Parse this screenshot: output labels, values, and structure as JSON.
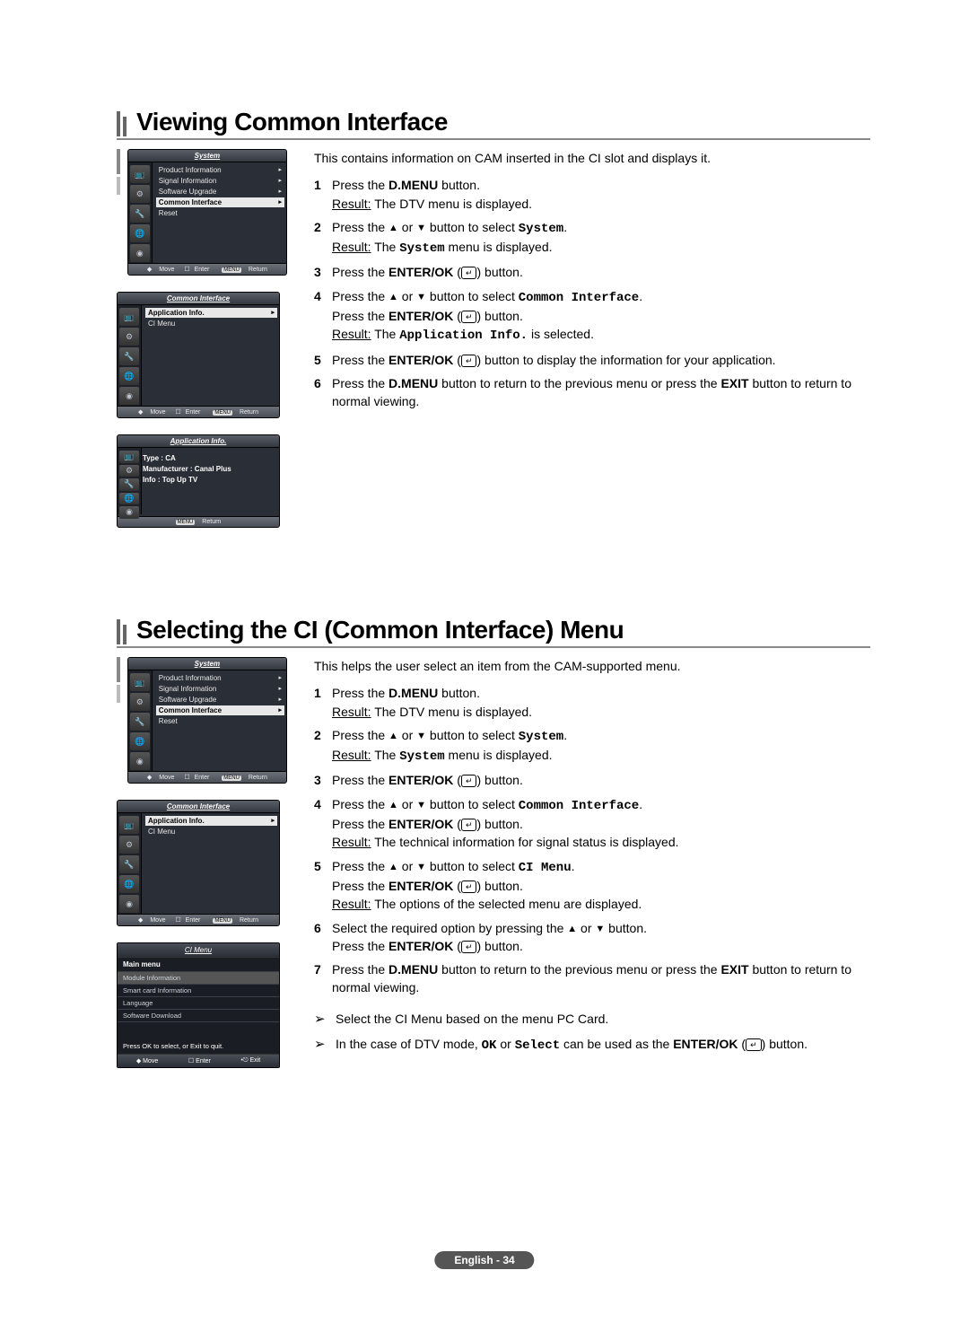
{
  "section1": {
    "heading": "Viewing Common Interface",
    "intro": "This contains information on CAM inserted in the CI slot and displays it.",
    "steps": {
      "s1_a": "Press the ",
      "s1_b": "D.MENU",
      "s1_c": " button.",
      "s1_r1": "Result:",
      "s1_r2": " The DTV menu is displayed.",
      "s2_a": "Press the ",
      "s2_b": " or ",
      "s2_c": " button to select ",
      "s2_d": "System",
      "s2_e": ".",
      "s2_r1": "Result:",
      "s2_r2": " The ",
      "s2_r3": "System",
      "s2_r4": " menu is displayed.",
      "s3_a": "Press the ",
      "s3_b": "ENTER/OK",
      "s3_c": " (",
      "s3_d": ") button.",
      "s4_a": "Press the ",
      "s4_b": " or ",
      "s4_c": " button to select ",
      "s4_d": "Common Interface",
      "s4_e": ".",
      "s4_f": "Press the ",
      "s4_g": "ENTER/OK",
      "s4_h": " (",
      "s4_i": ") button.",
      "s4_r1": "Result:",
      "s4_r2": " The ",
      "s4_r3": "Application Info.",
      "s4_r4": " is selected.",
      "s5_a": "Press the ",
      "s5_b": "ENTER/OK",
      "s5_c": " (",
      "s5_d": ") button to display the information for your application.",
      "s6_a": "Press the ",
      "s6_b": "D.MENU",
      "s6_c": " button to return to the previous menu or press the ",
      "s6_d": "EXIT",
      "s6_e": " button to return to normal viewing."
    },
    "osd1": {
      "title": "System",
      "items": [
        "Product Information",
        "Signal Information",
        "Software Upgrade",
        "Common Interface",
        "Reset"
      ],
      "selected": "Common Interface",
      "hints": {
        "move": "Move",
        "enter": "Enter",
        "ret": "Return"
      }
    },
    "osd2": {
      "title": "Common Interface",
      "items": [
        "Application Info.",
        "CI Menu"
      ],
      "selected": "Application Info.",
      "hints": {
        "move": "Move",
        "enter": "Enter",
        "ret": "Return"
      }
    },
    "osd3": {
      "title": "Application Info.",
      "type": "Type : CA",
      "manu": "Manufacturer : Canal Plus",
      "info": "Info : Top Up TV",
      "hints": {
        "ret": "Return"
      }
    }
  },
  "section2": {
    "heading": "Selecting the CI (Common Interface) Menu",
    "intro": "This helps the user select an item from the CAM-supported menu.",
    "steps": {
      "s1_a": "Press the ",
      "s1_b": "D.MENU",
      "s1_c": " button.",
      "s1_r1": "Result:",
      "s1_r2": " The DTV menu is displayed.",
      "s2_a": "Press the ",
      "s2_b": " or ",
      "s2_c": " button to select ",
      "s2_d": "System",
      "s2_e": ".",
      "s2_r1": "Result:",
      "s2_r2": " The ",
      "s2_r3": "System",
      "s2_r4": " menu is displayed.",
      "s3_a": "Press the ",
      "s3_b": "ENTER/OK",
      "s3_c": " (",
      "s3_d": ") button.",
      "s4_a": "Press the ",
      "s4_b": " or ",
      "s4_c": " button to select ",
      "s4_d": "Common Interface",
      "s4_e": ".",
      "s4_f": "Press the ",
      "s4_g": "ENTER/OK",
      "s4_h": " (",
      "s4_i": ") button.",
      "s4_r1": "Result:",
      "s4_r2": " The technical information for signal status is displayed.",
      "s5_a": "Press the ",
      "s5_b": " or ",
      "s5_c": " button to select ",
      "s5_d": "CI Menu",
      "s5_e": ".",
      "s5_f": "Press the ",
      "s5_g": "ENTER/OK",
      "s5_h": " (",
      "s5_i": ") button.",
      "s5_r1": "Result:",
      "s5_r2": " The options of the selected menu are displayed.",
      "s6_a": "Select the required option by pressing the ",
      "s6_b": " or ",
      "s6_c": " button.",
      "s6_d": "Press the ",
      "s6_e": "ENTER/OK",
      "s6_f": " (",
      "s6_g": ") button.",
      "s7_a": "Press the ",
      "s7_b": "D.MENU",
      "s7_c": " button to return to the previous menu or press the ",
      "s7_d": "EXIT",
      "s7_e": " button to return to normal viewing."
    },
    "notes": {
      "n1": "Select the CI Menu based on the menu PC Card.",
      "n2_a": "In the case of DTV mode, ",
      "n2_b": "OK",
      "n2_c": " or ",
      "n2_d": "Select",
      "n2_e": " can be used as the ",
      "n2_f": "ENTER/OK",
      "n2_g": " (",
      "n2_h": ") button."
    },
    "osd1": {
      "title": "System",
      "items": [
        "Product Information",
        "Signal Information",
        "Software Upgrade",
        "Common Interface",
        "Reset"
      ],
      "selected": "Common Interface",
      "hints": {
        "move": "Move",
        "enter": "Enter",
        "ret": "Return"
      }
    },
    "osd2": {
      "title": "Common Interface",
      "items": [
        "Application Info.",
        "CI Menu"
      ],
      "selected": "Application Info.",
      "hints": {
        "move": "Move",
        "enter": "Enter",
        "ret": "Return"
      }
    },
    "osd3": {
      "title": "CI Menu",
      "sub": "Main menu",
      "items": [
        "Module Information",
        "Smart card Information",
        "Language",
        "Software Download"
      ],
      "note": "Press OK to select, or Exit to quit.",
      "hints": {
        "move": "Move",
        "enter": "Enter",
        "exit": "Exit"
      }
    }
  },
  "footer": "English - 34",
  "glyphs": {
    "up": "▲",
    "down": "▼",
    "enter": "↵",
    "updown": "◆",
    "arrow": "➢",
    "caret": "▸",
    "menuBadge": "MENU",
    "exitIcon": "•⎋"
  }
}
